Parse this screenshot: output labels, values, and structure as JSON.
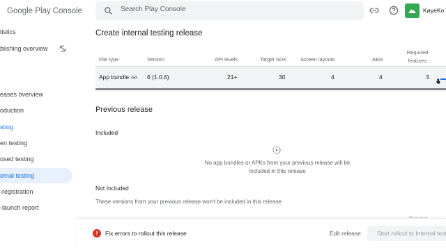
{
  "app": {
    "logo_google": "Google Play",
    "logo_console": " Console"
  },
  "sidebar": {
    "items": [
      {
        "label": "tistics"
      },
      {
        "label": "blishing overview"
      },
      {
        "label": "eases overview"
      },
      {
        "label": "oduction"
      },
      {
        "label": "sting"
      },
      {
        "label": "en testing"
      },
      {
        "label": "osed testing"
      },
      {
        "label": "ernal testing"
      },
      {
        "label": "-registration"
      },
      {
        "label": "-launch report"
      }
    ]
  },
  "topbar": {
    "search_placeholder": "Search Play Console",
    "account_name": "KøyeKo"
  },
  "main": {
    "title": "Create internal testing release",
    "table": {
      "headers": [
        "File type",
        "Version",
        "API levels",
        "Target SDK",
        "Screen layouts",
        "ABIs",
        "Required features"
      ],
      "row": {
        "file_type": "App bundle",
        "version": "6 (1.0.6)",
        "api_levels": "21+",
        "target_sdk": "30",
        "screen_layouts": "4",
        "abis": "4",
        "required_features": "3"
      }
    },
    "previous_release": {
      "title": "Previous release",
      "included_label": "Included",
      "empty_message": "No app bundles or APKs from your previous release will be included in this release",
      "not_included_label": "Not Included",
      "not_included_desc": "These versions from your previous release won't be included in this release",
      "faded_header": "Required"
    }
  },
  "footer": {
    "error_text": "Fix errors to rollout this release",
    "edit_label": "Edit release",
    "rollout_label": "Start rollout to Internal testing"
  },
  "colors": {
    "accent": "#1a73e8",
    "selected_bg": "#e8f0fe",
    "error": "#d93025",
    "avatar": "#34a853"
  }
}
